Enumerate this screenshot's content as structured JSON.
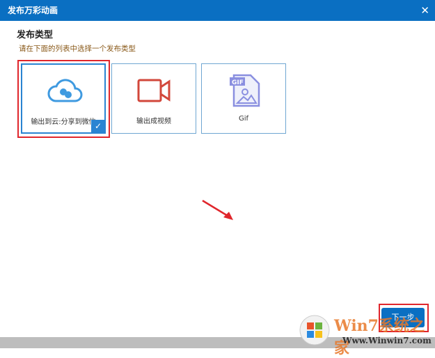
{
  "window": {
    "title": "发布万彩动画",
    "close_icon": "close-icon"
  },
  "heading": "发布类型",
  "subtitle": "请在下面的列表中选择一个发布类型",
  "options": [
    {
      "label": "输出到云:分享到微信",
      "icon": "cloud-wechat-icon",
      "selected": true
    },
    {
      "label": "输出成视频",
      "icon": "video-camera-icon",
      "selected": false
    },
    {
      "label": "Gif",
      "icon": "gif-file-icon",
      "selected": false
    }
  ],
  "next_button": "下一步",
  "watermark": {
    "brand": "Win7系统之家",
    "url": "Www.Winwin7.com"
  },
  "colors": {
    "accent": "#0a6fc2",
    "highlight": "#e0262c"
  }
}
